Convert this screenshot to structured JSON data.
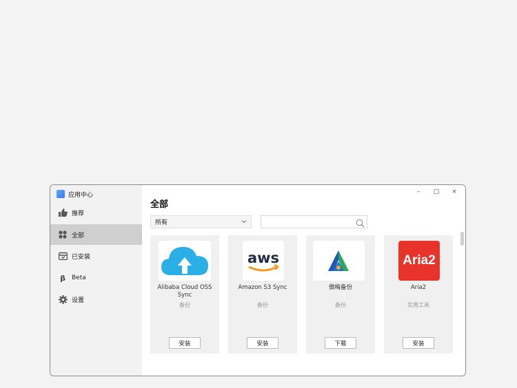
{
  "app": {
    "title": "应用中心"
  },
  "sidebar": {
    "items": [
      {
        "label": "推荐",
        "icon": "thumbs-up-icon"
      },
      {
        "label": "全部",
        "icon": "grid-icon",
        "active": true
      },
      {
        "label": "已安装",
        "icon": "installed-box-icon"
      },
      {
        "label": "Beta",
        "icon": "beta-icon"
      },
      {
        "label": "设置",
        "icon": "gear-icon"
      }
    ]
  },
  "window_controls": {
    "minimize": "–",
    "maximize": "□",
    "close": "×"
  },
  "main": {
    "title": "全部",
    "filter": {
      "selected": "所有"
    },
    "search": {
      "value": "",
      "placeholder": ""
    }
  },
  "apps": [
    {
      "name": "Alibaba Cloud OSS Sync",
      "category": "备份",
      "action": "安装",
      "icon": "alibaba-cloud-upload-icon"
    },
    {
      "name": "Amazon S3 Sync",
      "category": "备份",
      "action": "安装",
      "icon": "aws-logo-icon",
      "logo_text": "aws"
    },
    {
      "name": "傲梅备份",
      "category": "备份",
      "action": "下载",
      "icon": "aomei-triangle-icon"
    },
    {
      "name": "Aria2",
      "category": "实用工具",
      "action": "安装",
      "icon": "aria2-logo-icon",
      "logo_text": "Aria2"
    }
  ],
  "colors": {
    "accent": "#3d7bea",
    "aria_red": "#e8332a",
    "aws_orange": "#f29a1d",
    "cloud_blue": "#2ab0e6"
  }
}
